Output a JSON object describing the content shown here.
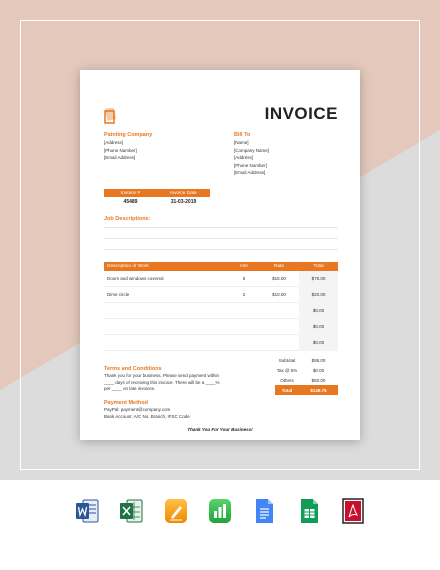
{
  "invoice": {
    "title": "INVOICE",
    "company": {
      "label": "Painting Company",
      "lines": [
        "[Address]",
        "[Phone Number]",
        "[Email Address]"
      ]
    },
    "bill_to": {
      "label": "Bill To",
      "lines": [
        "[Name]",
        "[Company Name]",
        "[Address]",
        "[Phone Number]",
        "[Email Address]"
      ]
    },
    "meta": {
      "headers": [
        "Invoice #",
        "Invoice Date"
      ],
      "values": [
        "45489",
        "31-03-2019"
      ]
    },
    "job_descriptions_label": "Job Descriptions:",
    "work_table": {
      "headers": [
        "Description of Work",
        "Hrs",
        "Rate",
        "Total"
      ],
      "rows": [
        [
          "Doors and windows covered",
          "5",
          "$15.00",
          "$75.00"
        ],
        [
          "Dime circle",
          "2",
          "$10.00",
          "$20.00"
        ],
        [
          "",
          "",
          "",
          "$0.00"
        ],
        [
          "",
          "",
          "",
          "$0.00"
        ],
        [
          "",
          "",
          "",
          "$0.00"
        ]
      ]
    },
    "summary": [
      [
        "Subtotal",
        "$95.00"
      ],
      [
        "Tax @ 5%",
        "$0.00"
      ],
      [
        "Others",
        "$50.00"
      ],
      [
        "Total",
        "$149.75"
      ]
    ],
    "terms": {
      "label": "Terms and Conditions",
      "lines": [
        "Thank you for your business. Please send payment within",
        "____ days of receiving this invoice. There will be a ____%",
        "per ____ on late invoices."
      ]
    },
    "payment": {
      "label": "Payment Method",
      "lines": [
        "PayPal: payment@company.com",
        "Bank Account: A/C No. Branch, IFSC Code"
      ]
    },
    "thanks": "Thank You For Your Business!"
  },
  "format_icons": [
    "word-icon",
    "excel-icon",
    "pages-icon",
    "numbers-icon",
    "google-docs-icon",
    "google-sheets-icon",
    "pdf-icon"
  ],
  "colors": {
    "accent": "#e87722",
    "bg_tan": "#e3c8bb",
    "bg_gray": "#dcdcdc"
  }
}
